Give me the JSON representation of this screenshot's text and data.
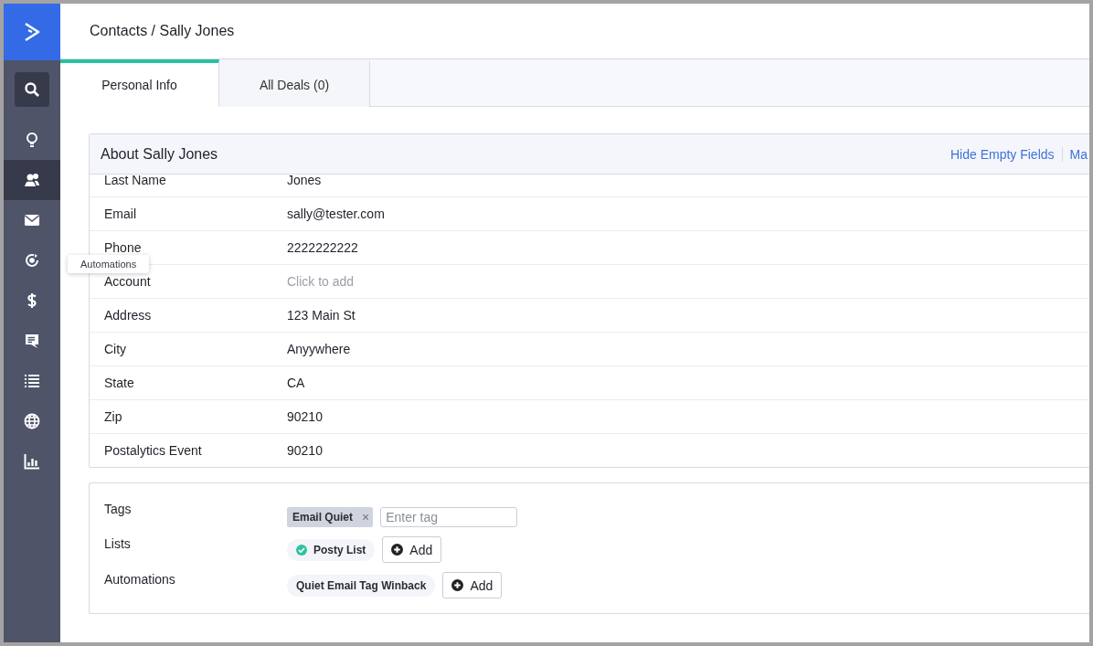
{
  "breadcrumb": "Contacts / Sally Jones",
  "sidebar": {
    "items": [
      {
        "kind": "search",
        "selected": false
      },
      {
        "kind": "nav",
        "selected": false
      },
      {
        "kind": "nav",
        "selected": true
      },
      {
        "kind": "nav",
        "selected": false
      },
      {
        "kind": "nav",
        "selected": false
      },
      {
        "kind": "nav",
        "selected": false
      },
      {
        "kind": "nav",
        "selected": false
      },
      {
        "kind": "nav",
        "selected": false
      },
      {
        "kind": "nav",
        "selected": false
      },
      {
        "kind": "nav",
        "selected": false
      }
    ],
    "tooltip": "Automations"
  },
  "tabs": [
    {
      "label": "Personal Info",
      "selected": true
    },
    {
      "label": "All Deals (0)",
      "selected": false
    }
  ],
  "about": {
    "title": "About Sally Jones",
    "links": [
      "Hide Empty Fields",
      "Ma"
    ],
    "rows": [
      {
        "label": "Last Name",
        "value": "Jones"
      },
      {
        "label": "Email",
        "value": "sally@tester.com"
      },
      {
        "label": "Phone",
        "value": "2222222222"
      },
      {
        "label": "Account",
        "placeholder": "Click to add"
      },
      {
        "label": "Address",
        "value": "123 Main St"
      },
      {
        "label": "City",
        "value": "Anyywhere"
      },
      {
        "label": "State",
        "value": "CA"
      },
      {
        "label": "Zip",
        "value": "90210"
      },
      {
        "label": "Postalytics Event",
        "value": "90210"
      }
    ]
  },
  "tags": {
    "label": "Tags",
    "items": [
      {
        "text": "Email Quiet",
        "remove": "×"
      }
    ],
    "placeholder": "Enter tag"
  },
  "lists": {
    "label": "Lists",
    "items": [
      {
        "text": "Posty List",
        "checked": true
      }
    ],
    "add": "Add"
  },
  "automations": {
    "label": "Automations",
    "items": [
      {
        "text": "Quiet Email Tag Winback"
      }
    ],
    "add": "Add"
  }
}
